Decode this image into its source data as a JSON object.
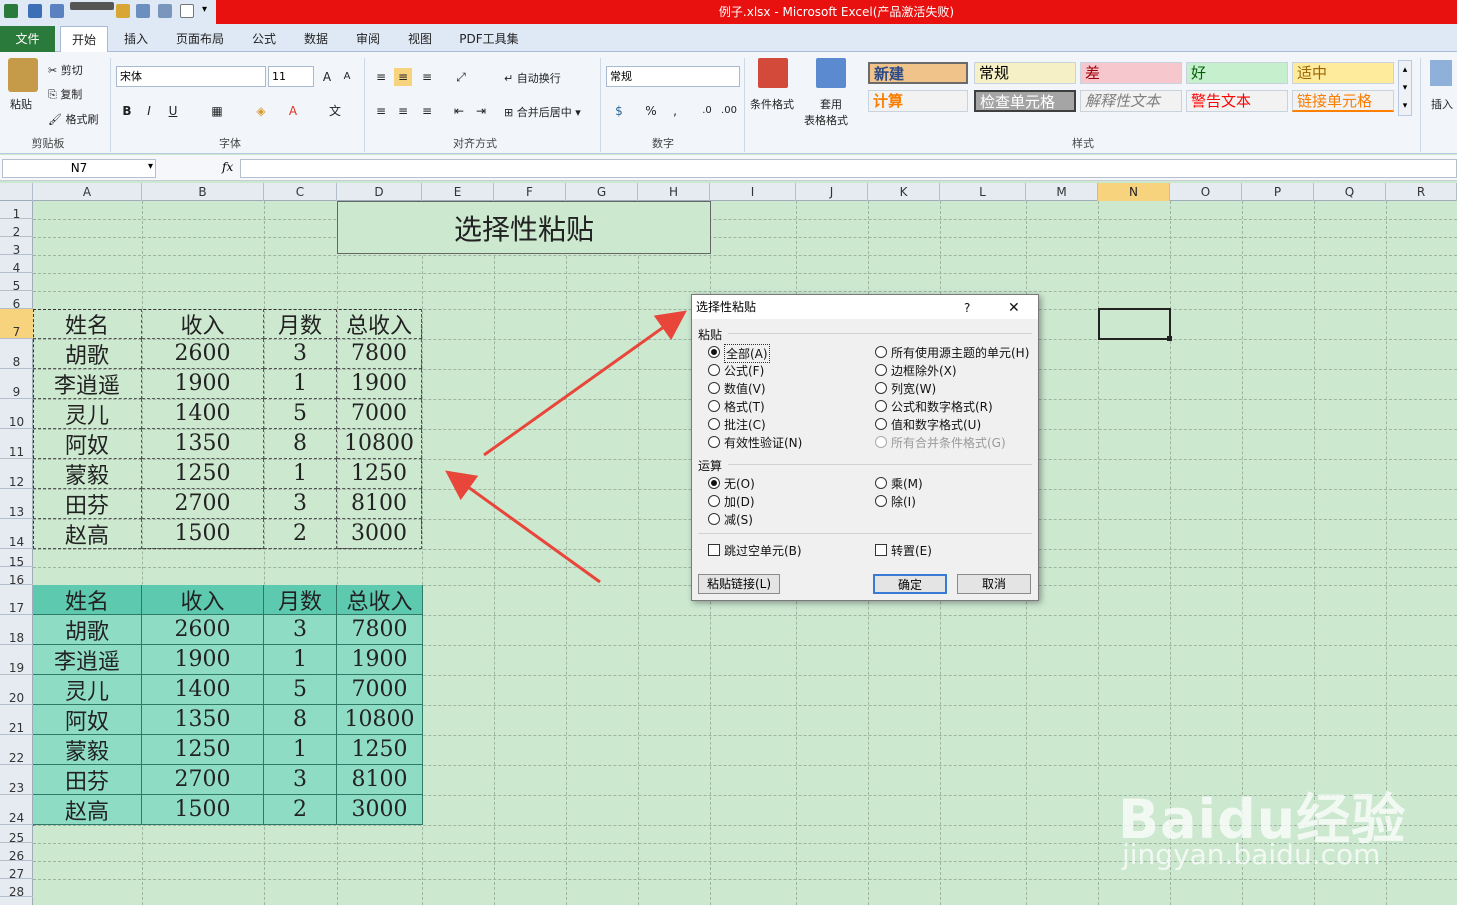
{
  "window": {
    "title": "例子.xlsx - Microsoft Excel(产品激活失败)"
  },
  "tabs": {
    "file": "文件",
    "items": [
      "开始",
      "插入",
      "页面布局",
      "公式",
      "数据",
      "审阅",
      "视图",
      "PDF工具集"
    ]
  },
  "ribbon": {
    "clipboard": {
      "paste": "粘贴",
      "cut": "剪切",
      "copy": "复制",
      "format_painter": "格式刷",
      "label": "剪贴板"
    },
    "font": {
      "name": "宋体",
      "size": "11",
      "label": "字体"
    },
    "alignment": {
      "wrap": "自动换行",
      "merge": "合并后居中",
      "label": "对齐方式"
    },
    "number": {
      "format": "常规",
      "label": "数字"
    },
    "styles": {
      "conditional": "条件格式",
      "table_fmt": "套用",
      "table_fmt2": "表格格式",
      "items": [
        "新建",
        "常规",
        "差",
        "好",
        "适中",
        "计算",
        "检查单元格",
        "解释性文本",
        "警告文本",
        "链接单元格"
      ],
      "label": "样式"
    },
    "insert": "插入"
  },
  "formula_bar": {
    "name_box": "N7",
    "fx": "fx",
    "value": ""
  },
  "columns": [
    "A",
    "B",
    "C",
    "D",
    "E",
    "F",
    "G",
    "H",
    "I",
    "J",
    "K",
    "L",
    "M",
    "N",
    "O",
    "P",
    "Q",
    "R"
  ],
  "rows": [
    "1",
    "2",
    "3",
    "4",
    "5",
    "6",
    "7",
    "8",
    "9",
    "10",
    "11",
    "12",
    "13",
    "14",
    "15",
    "16",
    "17",
    "18",
    "19",
    "20",
    "21",
    "22",
    "23",
    "24",
    "25",
    "26",
    "27",
    "28"
  ],
  "sheet": {
    "title": "选择性粘贴",
    "header": [
      "姓名",
      "收入",
      "月数",
      "总收入"
    ],
    "data": [
      [
        "胡歌",
        "2600",
        "3",
        "7800"
      ],
      [
        "李逍遥",
        "1900",
        "1",
        "1900"
      ],
      [
        "灵儿",
        "1400",
        "5",
        "7000"
      ],
      [
        "阿奴",
        "1350",
        "8",
        "10800"
      ],
      [
        "蒙毅",
        "1250",
        "1",
        "1250"
      ],
      [
        "田芬",
        "2700",
        "3",
        "8100"
      ],
      [
        "赵高",
        "1500",
        "2",
        "3000"
      ]
    ]
  },
  "dialog": {
    "title": "选择性粘贴",
    "help": "?",
    "close": "✕",
    "paste_section": "粘贴",
    "paste_left": [
      "全部(A)",
      "公式(F)",
      "数值(V)",
      "格式(T)",
      "批注(C)",
      "有效性验证(N)"
    ],
    "paste_right": [
      "所有使用源主题的单元(H)",
      "边框除外(X)",
      "列宽(W)",
      "公式和数字格式(R)",
      "值和数字格式(U)",
      "所有合并条件格式(G)"
    ],
    "op_section": "运算",
    "op_left": [
      "无(O)",
      "加(D)",
      "减(S)"
    ],
    "op_right": [
      "乘(M)",
      "除(I)"
    ],
    "skip_blanks": "跳过空单元(B)",
    "transpose": "转置(E)",
    "paste_link": "粘贴链接(L)",
    "ok": "确定",
    "cancel": "取消"
  },
  "watermark": {
    "brand": "Baidu经验",
    "url": "jingyan.baidu.com"
  },
  "colors": {
    "title_red": "#e8110f",
    "file_green": "#2a7a3b",
    "sheet_bg": "#cce8cf",
    "table2_header": "#5dcab0",
    "table2_body": "#8fdcc4",
    "arrow": "#e8463a"
  }
}
